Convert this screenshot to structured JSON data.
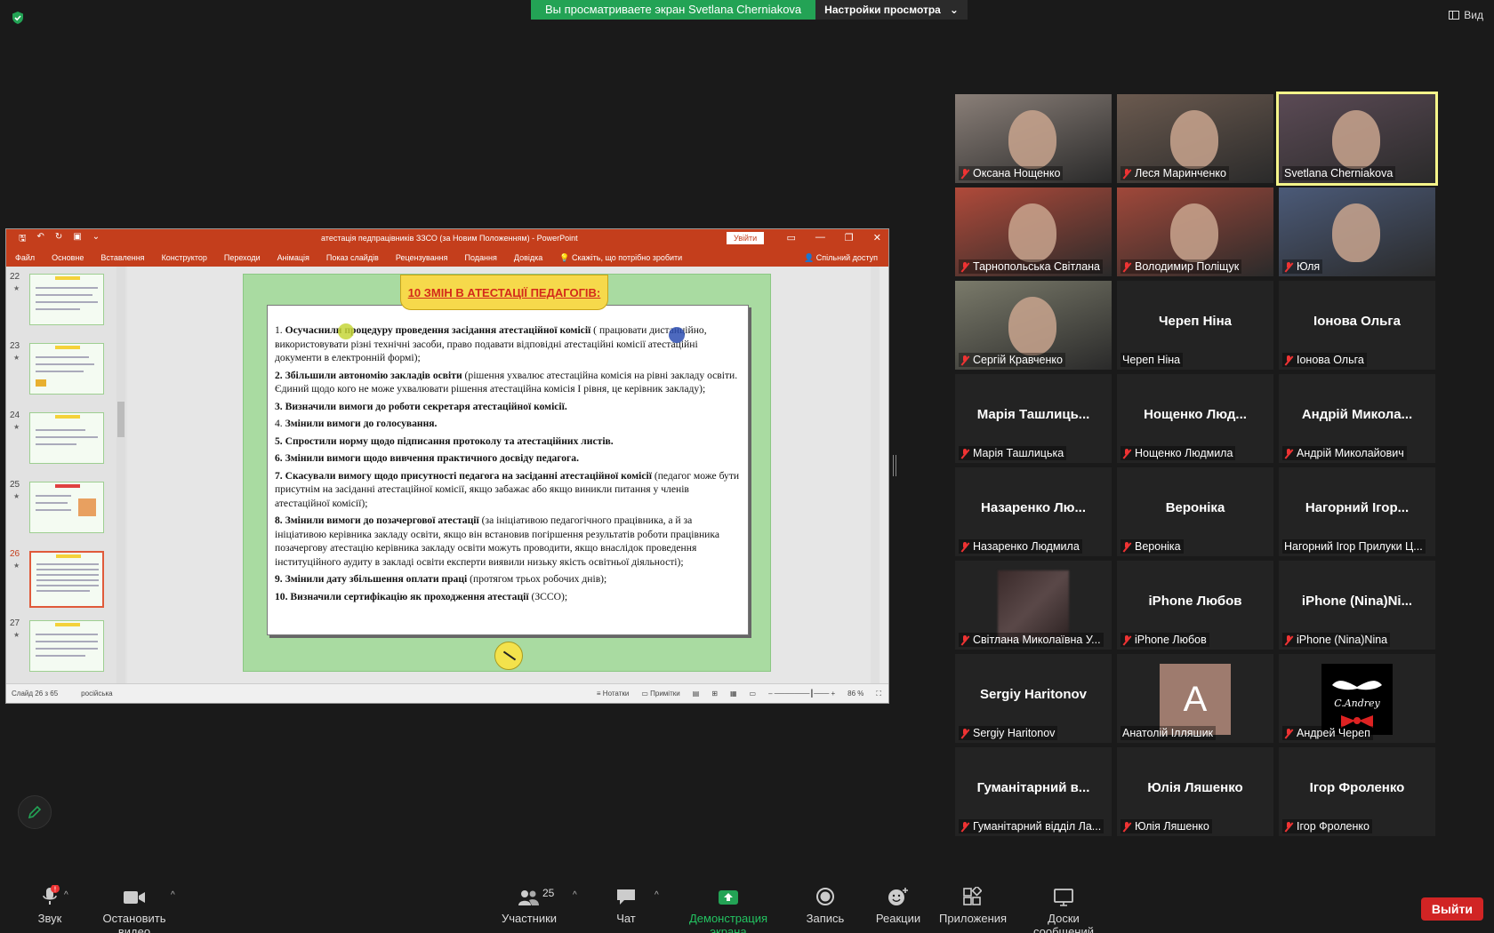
{
  "top_bar": {
    "sharing_banner": "Вы просматриваете экран Svetlana Cherniakova",
    "view_options": "Настройки просмотра",
    "view_button": "Вид"
  },
  "powerpoint": {
    "document_title": "атестація педпрацівників ЗЗСО (за Новим Положенням)  -  PowerPoint",
    "sign_in": "Увійти",
    "ribbon_tabs": [
      "Файл",
      "Основне",
      "Вставлення",
      "Конструктор",
      "Переходи",
      "Анімація",
      "Показ слайдів",
      "Рецензування",
      "Подання",
      "Довідка"
    ],
    "tell_me": "Скажіть, що потрібно зробити",
    "share": "Спільний доступ",
    "thumbnails": [
      {
        "num": "22",
        "star": "★"
      },
      {
        "num": "23",
        "star": "★"
      },
      {
        "num": "24",
        "star": "★"
      },
      {
        "num": "25",
        "star": "★"
      },
      {
        "num": "26",
        "star": "★"
      },
      {
        "num": "27",
        "star": "★"
      }
    ],
    "status": {
      "slide_count": "Слайд 26 з 65",
      "language": "російська",
      "notes": "Нотатки",
      "comments": "Примітки",
      "zoom": "86 %"
    },
    "slide": {
      "title": "10 ЗМІН В АТЕСТАЦІЇ ПЕДАГОГІВ:",
      "items": [
        {
          "bold": "Осучаснили процедуру проведення засідання атестаційної комісії",
          "rest": " ( працювати дистанційно, використовувати різні технічні засоби, право подавати відповідні атестаційні комісії атестаційні документи в електронній формі);",
          "prefix": "1. "
        },
        {
          "bold": "2. Збільшили автономію закладів освіти",
          "rest": " (рішення ухвалює атестаційна комісія на рівні закладу освіти. Єдиний щодо кого не може ухвалювати рішення атестаційна комісія І рівня, це керівник закладу);",
          "prefix": ""
        },
        {
          "bold": "3. Визначили вимоги до роботи секретаря атестаційної комісії.",
          "rest": "",
          "prefix": ""
        },
        {
          "bold": "Змінили вимоги до голосування.",
          "rest": "",
          "prefix": "4. "
        },
        {
          "bold": "5. Спростили норму щодо підписання протоколу та атестаційних листів.",
          "rest": "",
          "prefix": ""
        },
        {
          "bold": "6. Змінили вимоги щодо вивчення практичного досвіду педагога.",
          "rest": "",
          "prefix": ""
        },
        {
          "bold": "7. Скасували вимогу щодо присутності педагога на засіданні атестаційної комісії",
          "rest": " (педагог може бути присутнім на засіданні атестаційної комісії, якщо забажає або якщо виникли питання у членів атестаційної комісії);",
          "prefix": ""
        },
        {
          "bold": "8. Змінили вимоги до позачергової атестації",
          "rest": " (за ініціативою педагогічного працівника, а й за ініціативою керівника закладу освіти, якщо він встановив погіршення результатів роботи працівника позачергову атестацію керівника закладу освіти можуть проводити, якщо внаслідок проведення інституційного аудиту в закладі освіти експерти виявили низьку якість освітньої діяльності);",
          "prefix": ""
        },
        {
          "bold": "9. Змінили дату збільшення оплати праці",
          "rest": " (протягом трьох робочих днів);",
          "prefix": ""
        },
        {
          "bold": "10. Визначили сертифікацію як проходження атестації",
          "rest": " (ЗССО);",
          "prefix": ""
        }
      ]
    }
  },
  "participants": [
    {
      "name": "Оксана Нощенко",
      "big": "",
      "muted": true,
      "photo": "#8a7f78"
    },
    {
      "name": "Леся Маринченко",
      "big": "",
      "muted": true,
      "photo": "#6b5a4f"
    },
    {
      "name": "Svetlana Cherniakova",
      "big": "",
      "muted": false,
      "photo": "#5b4a55"
    },
    {
      "name": "Тарнопольська Світлана",
      "big": "",
      "muted": true,
      "photo": "#b04a3a"
    },
    {
      "name": "Володимир Поліщук",
      "big": "",
      "muted": true,
      "photo": "#a0483a"
    },
    {
      "name": "Юля",
      "big": "",
      "muted": true,
      "photo": "#4b5a78"
    },
    {
      "name": "Сергій Кравченко",
      "big": "",
      "muted": true,
      "photo": "#7a7a6a"
    },
    {
      "name": "Череп Ніна",
      "big": "Череп Ніна",
      "muted": false,
      "photo": ""
    },
    {
      "name": "Іонова Ольга",
      "big": "Іонова Ольга",
      "muted": true,
      "photo": ""
    },
    {
      "name": "Марія Ташлицька",
      "big": "Марія Ташлиць...",
      "muted": true,
      "photo": ""
    },
    {
      "name": "Нощенко Людмила",
      "big": "Нощенко Люд...",
      "muted": true,
      "photo": ""
    },
    {
      "name": "Андрій Миколайович",
      "big": "Андрій Микола...",
      "muted": true,
      "photo": ""
    },
    {
      "name": "Назаренко Людмила",
      "big": "Назаренко Лю...",
      "muted": true,
      "photo": ""
    },
    {
      "name": "Вероніка",
      "big": "Вероніка",
      "muted": true,
      "photo": ""
    },
    {
      "name": "Нагорний Ігор Прилуки Ц...",
      "big": "Нагорний Ігор...",
      "muted": false,
      "photo": ""
    },
    {
      "name": "Світлана Миколаївна У...",
      "big": "",
      "muted": true,
      "photo": "blur"
    },
    {
      "name": "iPhone Любов",
      "big": "iPhone Любов",
      "muted": true,
      "photo": ""
    },
    {
      "name": "iPhone (Nina)Nina",
      "big": "iPhone (Nina)Ni...",
      "muted": true,
      "photo": ""
    },
    {
      "name": "Sergiy Haritonov",
      "big": "Sergiy Haritonov",
      "muted": true,
      "photo": ""
    },
    {
      "name": "Анатолій Ілляшик",
      "big": "",
      "muted": false,
      "photo": "letter",
      "letter": "A"
    },
    {
      "name": "Андрей Череп",
      "big": "",
      "muted": true,
      "photo": "mustache",
      "logo_text": "C.Andrey"
    },
    {
      "name": "Гуманітарний відділ Ла...",
      "big": "Гуманітарний в...",
      "muted": true,
      "photo": ""
    },
    {
      "name": "Юлія Ляшенко",
      "big": "Юлія Ляшенко",
      "muted": true,
      "photo": ""
    },
    {
      "name": "Ігор Фроленко",
      "big": "Ігор Фроленко",
      "muted": true,
      "photo": ""
    }
  ],
  "toolbar": {
    "audio": "Звук",
    "video": "Остановить видео",
    "participants": "Участники",
    "participants_count": "25",
    "chat": "Чат",
    "share": "Демонстрация экрана",
    "record": "Запись",
    "reactions": "Реакции",
    "apps": "Приложения",
    "whiteboards": "Доски сообщений",
    "leave": "Выйти",
    "audio_alert": "!"
  },
  "colors": {
    "share_green": "#23a355",
    "ppt_red": "#c43e1c",
    "leave_red": "#d12424",
    "active_speaker": "#f5f58a"
  }
}
